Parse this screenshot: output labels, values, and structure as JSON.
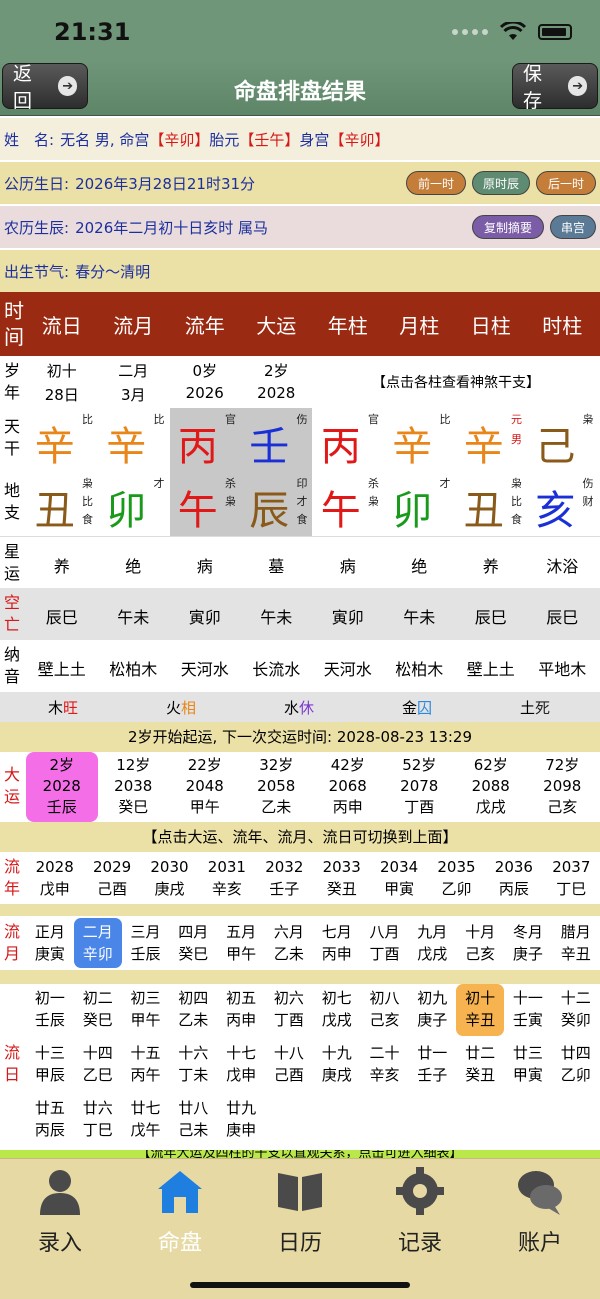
{
  "status": {
    "time": "21:31"
  },
  "nav": {
    "back_label": "返回",
    "title": "命盘排盘结果",
    "save_label": "保存"
  },
  "info": {
    "row1": {
      "label": "姓　名:",
      "text1": "无名 男, 命宫",
      "mingong": "【辛卯】",
      "text2": "胎元",
      "taiyuan": "【壬午】",
      "text3": "身宫",
      "shengong": "【辛卯】"
    },
    "row2": {
      "label": "公历生日:",
      "value": "2026年3月28日21时31分",
      "btn_prev": "前一时",
      "btn_orig": "原时辰",
      "btn_next": "后一时"
    },
    "row3": {
      "label": "农历生辰:",
      "value": "2026年二月初十日亥时 属马",
      "btn_copy": "复制摘要",
      "btn_str": "串宫"
    },
    "row4": {
      "label": "出生节气:",
      "value": "春分～清明"
    }
  },
  "chart": {
    "header_side": [
      "时",
      "间"
    ],
    "headers": [
      "流日",
      "流月",
      "流年",
      "大运",
      "年柱",
      "月柱",
      "日柱",
      "时柱"
    ],
    "age_side": [
      "岁",
      "年"
    ],
    "age_top": [
      "初十",
      "二月",
      "0岁",
      "2岁"
    ],
    "age_bottom": [
      "28日",
      "3月",
      "2026",
      "2028"
    ],
    "age_hint": "【点击各柱查看神煞干支】",
    "tian_side": [
      "天",
      "干"
    ],
    "stems": [
      "辛",
      "辛",
      "丙",
      "壬",
      "丙",
      "辛",
      "辛",
      "己"
    ],
    "stem_colors": [
      "#e8861a",
      "#e8861a",
      "#e01818",
      "#1a2fd6",
      "#e01818",
      "#e8861a",
      "#e8861a",
      "#8a5a1a"
    ],
    "stem_tags": [
      "比",
      "比",
      "官",
      "伤",
      "官",
      "比",
      "元",
      "枭"
    ],
    "stem_extra": [
      "",
      "",
      "",
      "",
      "",
      "",
      "男",
      ""
    ],
    "di_side": [
      "地",
      "支"
    ],
    "branches": [
      "丑",
      "卯",
      "午",
      "辰",
      "午",
      "卯",
      "丑",
      "亥"
    ],
    "branch_colors": [
      "#8a5a1a",
      "#1a9a1a",
      "#e01818",
      "#8a5a1a",
      "#e01818",
      "#1a9a1a",
      "#8a5a1a",
      "#1a2fd6"
    ],
    "branch_tags": [
      [
        "枭",
        "比",
        "食"
      ],
      [
        "才"
      ],
      [
        "杀",
        "枭"
      ],
      [
        "印",
        "才",
        "食"
      ],
      [
        "杀",
        "枭"
      ],
      [
        "才"
      ],
      [
        "枭",
        "比",
        "食"
      ],
      [
        "伤",
        "财"
      ]
    ],
    "xing_side": [
      "星",
      "运"
    ],
    "xingyun": [
      "养",
      "绝",
      "病",
      "墓",
      "病",
      "绝",
      "养",
      "沐浴"
    ],
    "kong_side": [
      "空",
      "亡"
    ],
    "kongwang": [
      "辰巳",
      "午未",
      "寅卯",
      "午未",
      "寅卯",
      "午未",
      "辰巳",
      "辰巳"
    ],
    "na_side": [
      "纳",
      "音"
    ],
    "nayin": [
      "壁上土",
      "松柏木",
      "天河水",
      "长流水",
      "天河水",
      "松柏木",
      "壁上土",
      "平地木"
    ],
    "wuxing": [
      {
        "el": "木",
        "st": "旺",
        "color": "#e01818"
      },
      {
        "el": "火",
        "st": "相",
        "color": "#e8861a"
      },
      {
        "el": "水",
        "st": "休",
        "color": "#7a3ad0"
      },
      {
        "el": "金",
        "st": "囚",
        "color": "#2a8ae0"
      },
      {
        "el": "土",
        "st": "死",
        "color": "#222222"
      }
    ]
  },
  "dayun": {
    "start_text": "2岁开始起运, 下一次交运时间: 2028-08-23 13:29",
    "side": [
      "大",
      "运"
    ],
    "items": [
      {
        "age": "2岁",
        "year": "2028",
        "gz": "壬辰"
      },
      {
        "age": "12岁",
        "year": "2038",
        "gz": "癸巳"
      },
      {
        "age": "22岁",
        "year": "2048",
        "gz": "甲午"
      },
      {
        "age": "32岁",
        "year": "2058",
        "gz": "乙未"
      },
      {
        "age": "42岁",
        "year": "2068",
        "gz": "丙申"
      },
      {
        "age": "52岁",
        "year": "2078",
        "gz": "丁酉"
      },
      {
        "age": "62岁",
        "year": "2088",
        "gz": "戊戌"
      },
      {
        "age": "72岁",
        "year": "2098",
        "gz": "己亥"
      }
    ],
    "hint": "【点击大运、流年、流月、流日可切换到上面】"
  },
  "liunian": {
    "side": [
      "流",
      "年"
    ],
    "items": [
      {
        "year": "2028",
        "gz": "戊申"
      },
      {
        "year": "2029",
        "gz": "己酉"
      },
      {
        "year": "2030",
        "gz": "庚戌"
      },
      {
        "year": "2031",
        "gz": "辛亥"
      },
      {
        "year": "2032",
        "gz": "壬子"
      },
      {
        "year": "2033",
        "gz": "癸丑"
      },
      {
        "year": "2034",
        "gz": "甲寅"
      },
      {
        "year": "2035",
        "gz": "乙卯"
      },
      {
        "year": "2036",
        "gz": "丙辰"
      },
      {
        "year": "2037",
        "gz": "丁巳"
      }
    ]
  },
  "liuyue": {
    "side": [
      "流",
      "月"
    ],
    "items": [
      {
        "m": "正月",
        "gz": "庚寅"
      },
      {
        "m": "二月",
        "gz": "辛卯"
      },
      {
        "m": "三月",
        "gz": "壬辰"
      },
      {
        "m": "四月",
        "gz": "癸巳"
      },
      {
        "m": "五月",
        "gz": "甲午"
      },
      {
        "m": "六月",
        "gz": "乙未"
      },
      {
        "m": "七月",
        "gz": "丙申"
      },
      {
        "m": "八月",
        "gz": "丁酉"
      },
      {
        "m": "九月",
        "gz": "戊戌"
      },
      {
        "m": "十月",
        "gz": "己亥"
      },
      {
        "m": "冬月",
        "gz": "庚子"
      },
      {
        "m": "腊月",
        "gz": "辛丑"
      }
    ]
  },
  "liuri": {
    "side": [
      "流",
      "日"
    ],
    "rows": [
      [
        {
          "d": "初一",
          "gz": "壬辰"
        },
        {
          "d": "初二",
          "gz": "癸巳"
        },
        {
          "d": "初三",
          "gz": "甲午"
        },
        {
          "d": "初四",
          "gz": "乙未"
        },
        {
          "d": "初五",
          "gz": "丙申"
        },
        {
          "d": "初六",
          "gz": "丁酉"
        },
        {
          "d": "初七",
          "gz": "戊戌"
        },
        {
          "d": "初八",
          "gz": "己亥"
        },
        {
          "d": "初九",
          "gz": "庚子"
        },
        {
          "d": "初十",
          "gz": "辛丑"
        },
        {
          "d": "十一",
          "gz": "壬寅"
        },
        {
          "d": "十二",
          "gz": "癸卯"
        }
      ],
      [
        {
          "d": "十三",
          "gz": "甲辰"
        },
        {
          "d": "十四",
          "gz": "乙巳"
        },
        {
          "d": "十五",
          "gz": "丙午"
        },
        {
          "d": "十六",
          "gz": "丁未"
        },
        {
          "d": "十七",
          "gz": "戊申"
        },
        {
          "d": "十八",
          "gz": "己酉"
        },
        {
          "d": "十九",
          "gz": "庚戌"
        },
        {
          "d": "二十",
          "gz": "辛亥"
        },
        {
          "d": "廿一",
          "gz": "壬子"
        },
        {
          "d": "廿二",
          "gz": "癸丑"
        },
        {
          "d": "廿三",
          "gz": "甲寅"
        },
        {
          "d": "廿四",
          "gz": "乙卯"
        }
      ],
      [
        {
          "d": "廿五",
          "gz": "丙辰"
        },
        {
          "d": "廿六",
          "gz": "丁巳"
        },
        {
          "d": "廿七",
          "gz": "戊午"
        },
        {
          "d": "廿八",
          "gz": "己未"
        },
        {
          "d": "廿九",
          "gz": "庚申"
        }
      ]
    ],
    "bottom_hint": "【流年大运及四柱的干支以直观关系，点击可进入细表】"
  },
  "tabs": [
    {
      "label": "录入",
      "icon": "user-icon"
    },
    {
      "label": "命盘",
      "icon": "home-icon"
    },
    {
      "label": "日历",
      "icon": "book-icon"
    },
    {
      "label": "记录",
      "icon": "gear-icon"
    },
    {
      "label": "账户",
      "icon": "chat-icon"
    }
  ]
}
